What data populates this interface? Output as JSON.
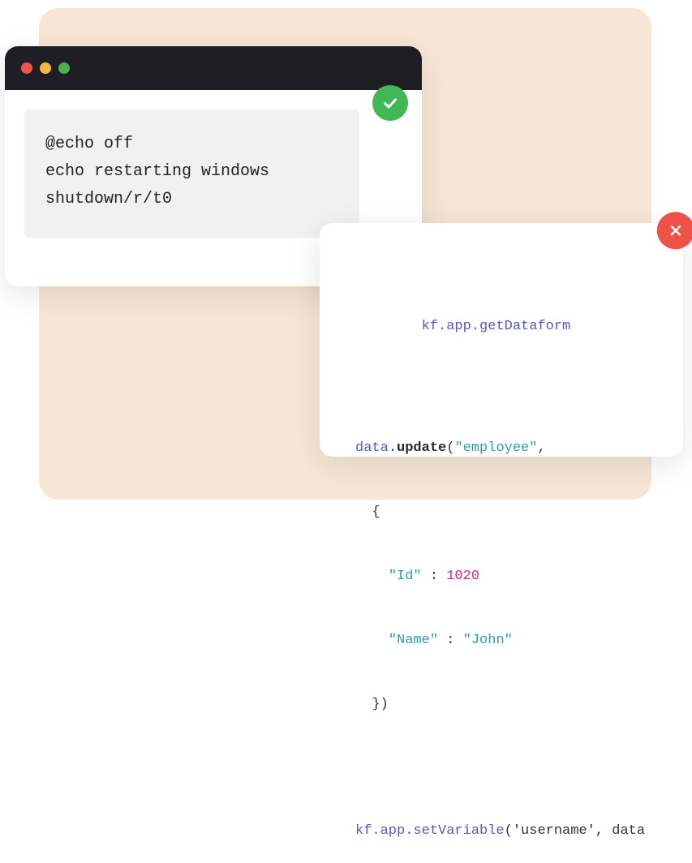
{
  "window": {
    "code_line1": "@echo off",
    "code_line2": "echo restarting windows",
    "code_line3": "shutdown/r/t0"
  },
  "snippet": {
    "line1_indent": "        ",
    "line1_obj": "kf.app.getDataform",
    "line2_obj": "data",
    "line2_dot": ".",
    "line2_call": "update",
    "line2_paren": "(",
    "line2_str": "\"employee\"",
    "line2_tail": ",",
    "line3": "  {",
    "line4_pre": "    ",
    "line4_key": "\"Id\"",
    "line4_mid": " : ",
    "line4_val": "1020",
    "line5_pre": "    ",
    "line5_key": "\"Name\"",
    "line5_mid": " : ",
    "line5_val": "\"John\"",
    "line6": "  })",
    "line7_obj": "kf.app.setVariable",
    "line7_tail": "('username', data"
  },
  "icons": {
    "check": "check",
    "cross": "cross"
  }
}
